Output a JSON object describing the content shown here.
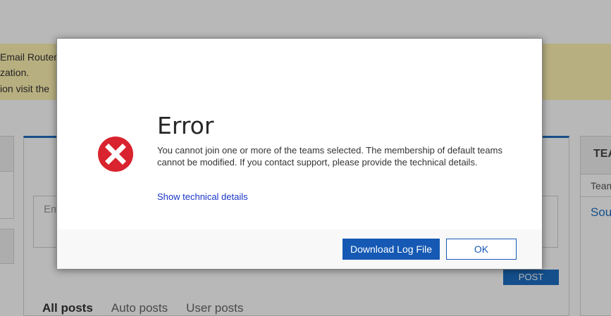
{
  "background": {
    "notice": {
      "line1": "Email Router",
      "line2": "zation.",
      "line3": "ion visit the"
    },
    "post_placeholder": "Em",
    "post_label": "POST",
    "feed_tabs": [
      {
        "label": "All posts",
        "active": true
      },
      {
        "label": "Auto posts",
        "active": false
      },
      {
        "label": "User posts",
        "active": false
      }
    ],
    "right_panel": {
      "header": "TEA",
      "column": "Team",
      "link": "Sou"
    }
  },
  "dialog": {
    "icon": "error-x-icon",
    "title": "Error",
    "message": "You cannot join one or more of the teams selected. The membership of default teams cannot be modified. If you contact support, please provide the technical details.",
    "details_link": "Show technical details",
    "download_label": "Download Log File",
    "ok_label": "OK"
  },
  "colors": {
    "accent": "#1559b4",
    "error_red": "#d9232e",
    "notice_bg": "#fff3b2"
  }
}
